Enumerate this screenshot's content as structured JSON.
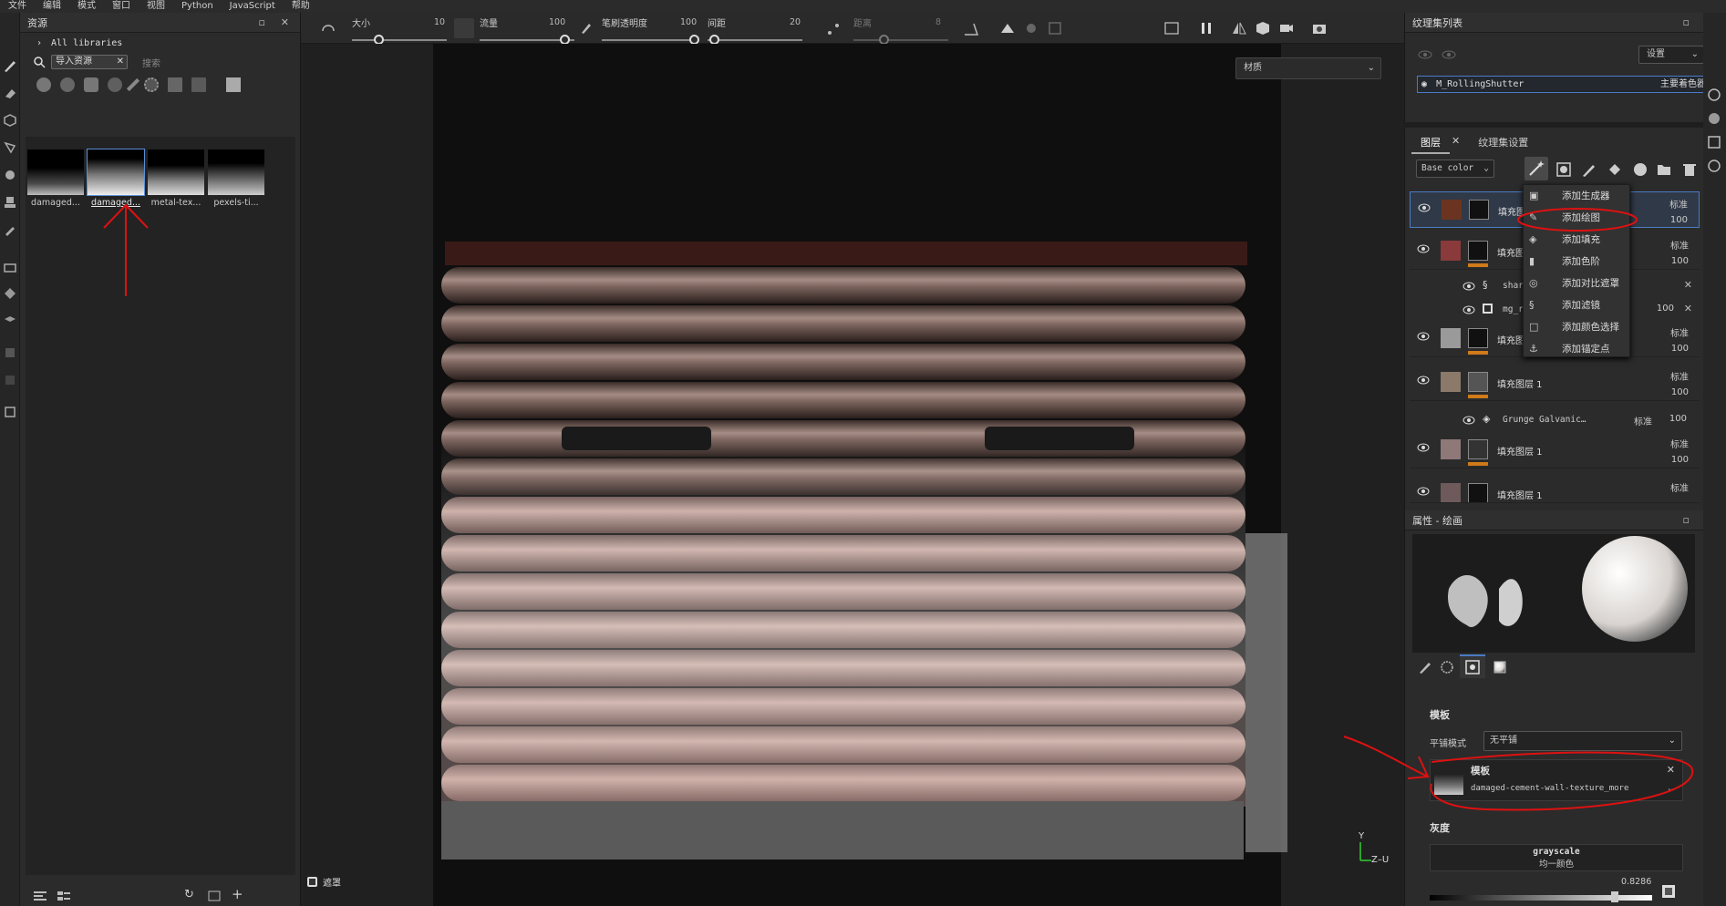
{
  "menu": [
    "文件",
    "编辑",
    "模式",
    "窗口",
    "视图",
    "Python",
    "JavaScript",
    "帮助"
  ],
  "assets_panel": {
    "title": "资源",
    "tree_item": "All libraries",
    "search_chip": "导入资源",
    "search_placeholder": "搜索",
    "thumbnails": [
      "damaged...",
      "damaged...",
      "metal-tex...",
      "pexels-ti..."
    ]
  },
  "toolbar": {
    "size_label": "大小",
    "size_value": "10",
    "flow_label": "流量",
    "flow_value": "100",
    "stroke_opacity_label": "笔刷透明度",
    "stroke_opacity_value": "100",
    "spacing_label": "间距",
    "spacing_value": "20",
    "distance_label": "距离",
    "distance_value": "8"
  },
  "viewport": {
    "material_dropdown": "材质",
    "mask_label": "遮罩",
    "axis_y": "Y",
    "axis_x": "Z–U"
  },
  "texture_set_list": {
    "title": "纹理集列表",
    "settings_btn": "设置",
    "set_name": "M_RollingShutter",
    "shader": "主要着色器"
  },
  "layers_panel": {
    "tabs": [
      "图层",
      "纹理集设置"
    ],
    "channel": "Base color",
    "layers": [
      {
        "name": "填充图层 1",
        "blend": "标准",
        "opacity": "100"
      },
      {
        "name": "填充图",
        "blend": "标准",
        "opacity": "100"
      },
      {
        "name": "填充图",
        "blend": "标准",
        "opacity": "100"
      },
      {
        "name": "填充图层 1",
        "blend": "标准",
        "opacity": "100"
      },
      {
        "name": "填充图层 1",
        "blend": "标准",
        "opacity": "100"
      },
      {
        "name": "填充图层 1",
        "blend": "标准",
        "opacity": ""
      }
    ],
    "sub_rows": [
      {
        "name": "shar"
      },
      {
        "name": "mg_r",
        "opacity": "100"
      },
      {
        "name": "Grunge Galvanic…",
        "blend": "标准",
        "opacity": "100"
      }
    ]
  },
  "context_menu": [
    "添加生成器",
    "添加绘图",
    "添加填充",
    "添加色阶",
    "添加对比遮罩",
    "添加滤镜",
    "添加颜色选择",
    "添加锚定点"
  ],
  "properties": {
    "title": "属性 - 绘画",
    "stencil_section": "模板",
    "tiling_label": "平铺模式",
    "tiling_value": "无平铺",
    "stencil_title": "模板",
    "stencil_file": "damaged-cement-wall-texture_more",
    "gray_section": "灰度",
    "gray_name": "grayscale",
    "gray_sub": "均一颜色",
    "gray_value": "0.8286"
  },
  "colors": {
    "accent": "#4a7bc4",
    "annotation": "#dd1111",
    "orange_bar": "#d07a1a"
  }
}
